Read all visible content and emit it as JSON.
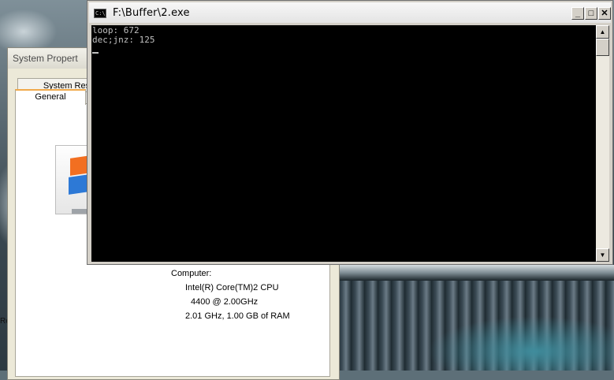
{
  "system_properties": {
    "title": "System Propert",
    "tabs": [
      {
        "label": "System Rest"
      },
      {
        "label": "General"
      }
    ],
    "info": {
      "computer_label": "Computer:",
      "cpu_line1": "Intel(R) Core(TM)2 CPU",
      "cpu_line2": "4400  @ 2.00GHz",
      "cpu_line3": "2.01 GHz, 1.00 GB of RAM"
    }
  },
  "desktop": {
    "stray_text": "Re"
  },
  "console": {
    "icon_label": "C:\\",
    "title": "F:\\Buffer\\2.exe",
    "lines": [
      "loop: 672",
      "dec;jnz: 125"
    ],
    "buttons": {
      "minimize": "_",
      "maximize": "□",
      "close": "✕"
    }
  }
}
